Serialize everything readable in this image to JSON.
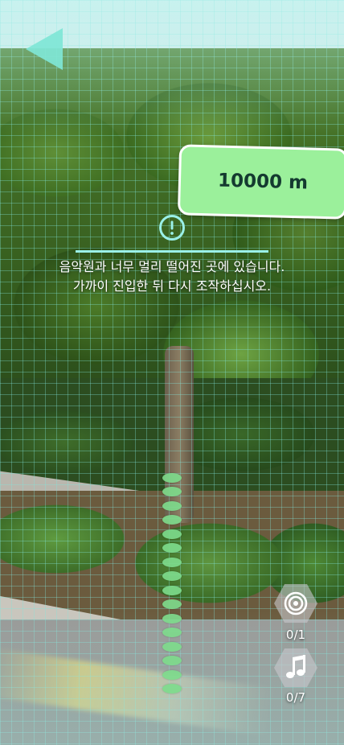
{
  "header": {
    "back_icon": "back-triangle-icon"
  },
  "distance": {
    "label": "10000 m",
    "color": "#9bf09b"
  },
  "warning": {
    "icon": "exclamation-circle-icon",
    "line1": "음악원과 너무 멀리 떨어진 곳에 있습니다.",
    "line2": "가까이 진입한 뒤 다시 조작하십시오."
  },
  "progress_dots": {
    "count": 16,
    "color": "#7edc8c"
  },
  "badges": [
    {
      "icon": "target-rings-icon",
      "count": "0/1"
    },
    {
      "icon": "music-note-icon",
      "count": "0/7"
    }
  ]
}
